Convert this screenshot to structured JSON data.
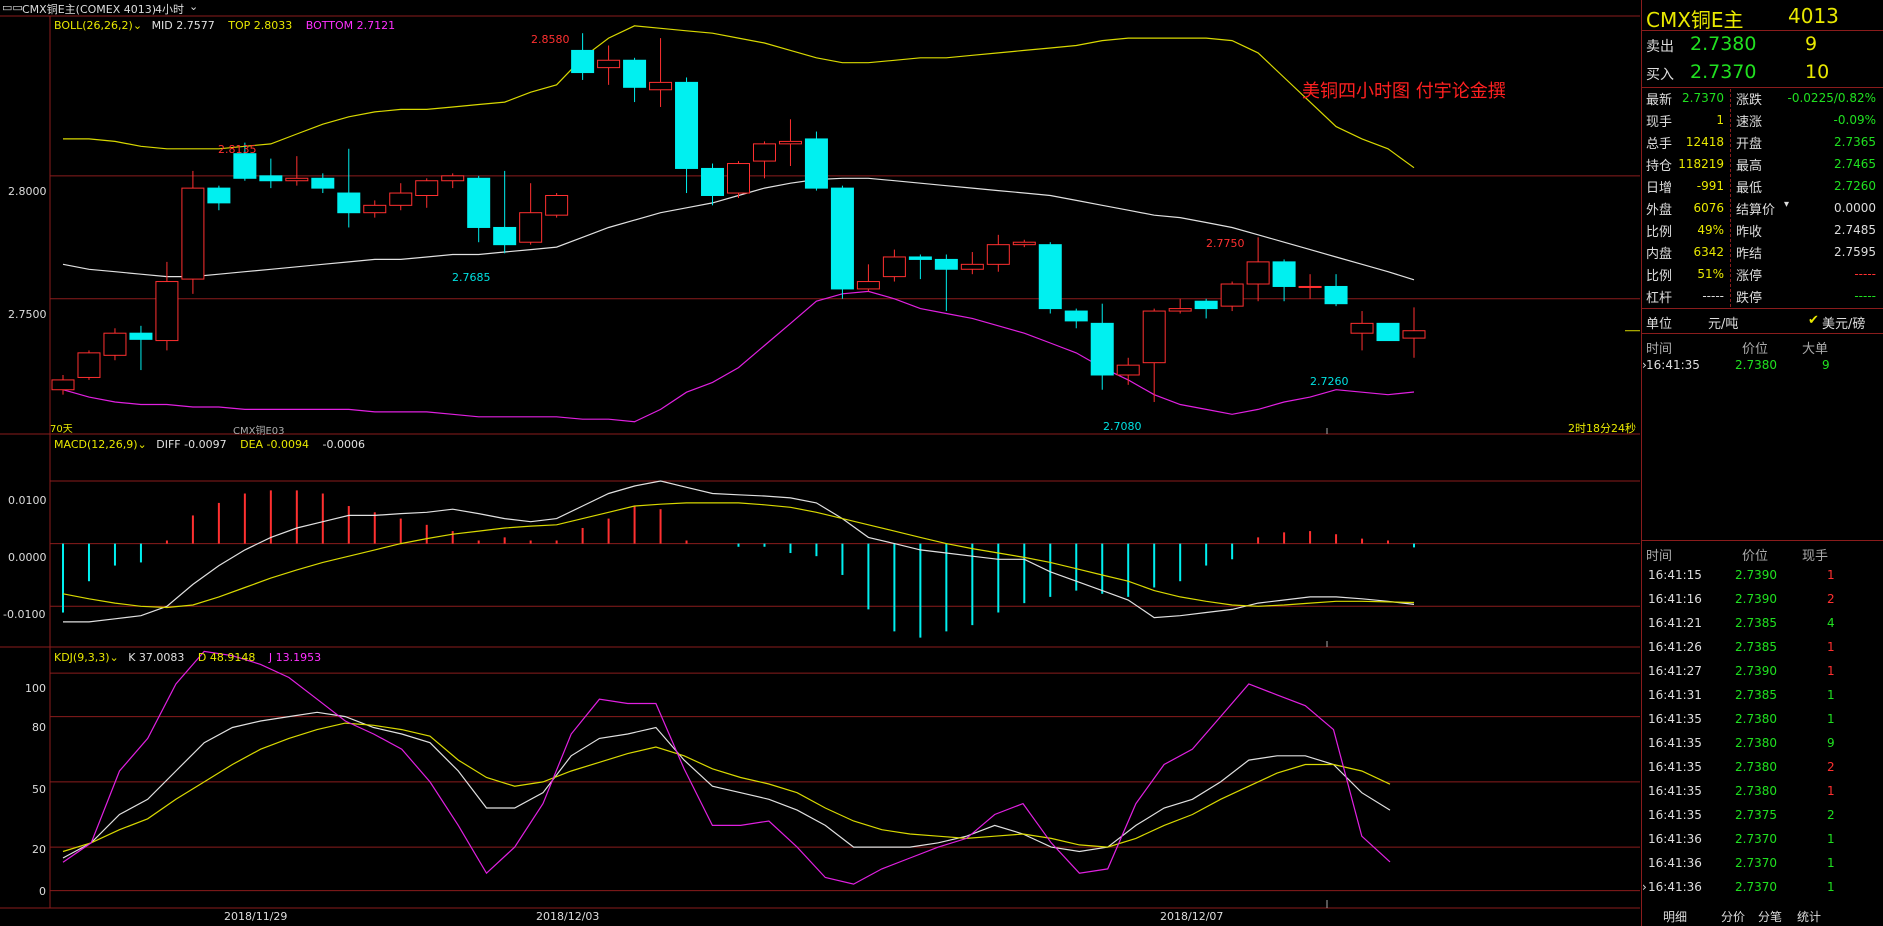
{
  "header": {
    "title": "CMX铜E主(COMEX 4013)",
    "period": "4小时",
    "period_chevron": "chevron-down-icon"
  },
  "boll": {
    "name": "BOLL(26,26,2)",
    "mid": "MID 2.7577",
    "top": "TOP 2.8033",
    "bottom": "BOTTOM 2.7121"
  },
  "macd": {
    "name": "MACD(12,26,9)",
    "diff": "DIFF -0.0097",
    "dea": "DEA -0.0094",
    "macd": "-0.0006"
  },
  "kdj": {
    "name": "KDJ(9,3,3)",
    "k": "K 37.0083",
    "d": "D 48.9148",
    "j": "J 13.1953"
  },
  "main_axis": {
    "labels": [
      "2.8000",
      "2.7500"
    ],
    "values": [
      2.8,
      2.75
    ]
  },
  "macd_axis": {
    "labels": [
      "0.0100",
      "0.0000",
      "-0.0100"
    ],
    "values": [
      0.01,
      0.0,
      -0.01
    ]
  },
  "kdj_axis": {
    "labels": [
      "100",
      "80",
      "50",
      "20",
      "0"
    ],
    "values": [
      100,
      80,
      50,
      20,
      0
    ]
  },
  "date_labels": [
    "2018/11/29",
    "2018/12/03",
    "2018/12/07"
  ],
  "annotations": {
    "watermark": "美铜四小时图 付宇论金撰",
    "hi1": "2.8135",
    "hi2": "2.8580",
    "lo1": "2.7685",
    "hi3": "2.7750",
    "lo2": "2.7080",
    "lo3": "2.7260",
    "left_tag": "70天",
    "sub_tag": "CMX铜E03",
    "countdown": "2时18分24秒"
  },
  "quote": {
    "symbol": "CMX铜E主",
    "code": "4013",
    "ask_label": "卖出",
    "ask_price": "2.7380",
    "ask_vol": "9",
    "bid_label": "买入",
    "bid_price": "2.7370",
    "bid_vol": "10",
    "rows": [
      {
        "l1": "最新",
        "v1": "2.7370",
        "c1": "grn",
        "l2": "涨跌",
        "v2": "-0.0225/0.82%",
        "c2": "grn"
      },
      {
        "l1": "现手",
        "v1": "1",
        "c1": "yel",
        "l2": "速涨",
        "v2": "-0.09%",
        "c2": "grn"
      },
      {
        "l1": "总手",
        "v1": "12418",
        "c1": "yel",
        "l2": "开盘",
        "v2": "2.7365",
        "c2": "grn"
      },
      {
        "l1": "持仓",
        "v1": "118219",
        "c1": "yel",
        "l2": "最高",
        "v2": "2.7465",
        "c2": "grn"
      },
      {
        "l1": "日增",
        "v1": "-991",
        "c1": "yel",
        "l2": "最低",
        "v2": "2.7260",
        "c2": "grn"
      },
      {
        "l1": "外盘",
        "v1": "6076",
        "c1": "yel",
        "l2": "结算价",
        "v2": "0.0000",
        "c2": "lbl"
      },
      {
        "l1": "比例",
        "v1": "49%",
        "c1": "yel",
        "l2": "昨收",
        "v2": "2.7485",
        "c2": "lbl"
      },
      {
        "l1": "内盘",
        "v1": "6342",
        "c1": "yel",
        "l2": "昨结",
        "v2": "2.7595",
        "c2": "lbl"
      },
      {
        "l1": "比例",
        "v1": "51%",
        "c1": "yel",
        "l2": "涨停",
        "v2": "-----",
        "c2": "red"
      },
      {
        "l1": "杠杆",
        "v1": "-----",
        "c1": "lbl",
        "l2": "跌停",
        "v2": "-----",
        "c2": "grn"
      }
    ],
    "unit_label": "单位",
    "unit_value": "元/吨",
    "unit_alt": "美元/磅",
    "unit_check": "check-icon"
  },
  "big_orders": {
    "headers": [
      "时间",
      "价位",
      "大单"
    ],
    "rows": [
      {
        "time": "16:41:35",
        "price": "2.7380",
        "vol": "9"
      }
    ]
  },
  "ticks": {
    "headers": [
      "时间",
      "价位",
      "现手"
    ],
    "rows": [
      {
        "time": "16:41:15",
        "price": "2.7390",
        "vol": "1",
        "c": "red"
      },
      {
        "time": "16:41:16",
        "price": "2.7390",
        "vol": "2",
        "c": "red"
      },
      {
        "time": "16:41:21",
        "price": "2.7385",
        "vol": "4",
        "c": "grn"
      },
      {
        "time": "16:41:26",
        "price": "2.7385",
        "vol": "1",
        "c": "red"
      },
      {
        "time": "16:41:27",
        "price": "2.7390",
        "vol": "1",
        "c": "red"
      },
      {
        "time": "16:41:31",
        "price": "2.7385",
        "vol": "1",
        "c": "grn"
      },
      {
        "time": "16:41:35",
        "price": "2.7380",
        "vol": "1",
        "c": "grn"
      },
      {
        "time": "16:41:35",
        "price": "2.7380",
        "vol": "9",
        "c": "grn"
      },
      {
        "time": "16:41:35",
        "price": "2.7380",
        "vol": "2",
        "c": "red"
      },
      {
        "time": "16:41:35",
        "price": "2.7380",
        "vol": "1",
        "c": "red"
      },
      {
        "time": "16:41:35",
        "price": "2.7375",
        "vol": "2",
        "c": "grn"
      },
      {
        "time": "16:41:36",
        "price": "2.7370",
        "vol": "1",
        "c": "grn"
      },
      {
        "time": "16:41:36",
        "price": "2.7370",
        "vol": "1",
        "c": "grn"
      },
      {
        "time": "16:41:36",
        "price": "2.7370",
        "vol": "1",
        "c": "grn"
      }
    ]
  },
  "tabs": [
    "明细",
    "分价",
    "分笔",
    "统计"
  ],
  "colors": {
    "up": "#ff3030",
    "down": "#00f0f0",
    "grid": "#8a1c1c",
    "mid": "#e0e0e0",
    "top": "#d8d800",
    "bottom": "#e020e0"
  },
  "chart_data": {
    "type": "candlestick",
    "candles": [
      {
        "o": 2.713,
        "c": 2.717,
        "h": 2.719,
        "l": 2.711
      },
      {
        "o": 2.718,
        "c": 2.728,
        "h": 2.729,
        "l": 2.717
      },
      {
        "o": 2.727,
        "c": 2.736,
        "h": 2.738,
        "l": 2.725
      },
      {
        "o": 2.736,
        "c": 2.7335,
        "h": 2.739,
        "l": 2.721
      },
      {
        "o": 2.733,
        "c": 2.757,
        "h": 2.765,
        "l": 2.729
      },
      {
        "o": 2.758,
        "c": 2.795,
        "h": 2.802,
        "l": 2.752
      },
      {
        "o": 2.795,
        "c": 2.789,
        "h": 2.796,
        "l": 2.786
      },
      {
        "o": 2.809,
        "c": 2.799,
        "h": 2.8135,
        "l": 2.798
      },
      {
        "o": 2.8,
        "c": 2.798,
        "h": 2.807,
        "l": 2.795
      },
      {
        "o": 2.798,
        "c": 2.799,
        "h": 2.808,
        "l": 2.796
      },
      {
        "o": 2.799,
        "c": 2.795,
        "h": 2.801,
        "l": 2.793
      },
      {
        "o": 2.793,
        "c": 2.785,
        "h": 2.811,
        "l": 2.779
      },
      {
        "o": 2.785,
        "c": 2.788,
        "h": 2.79,
        "l": 2.783
      },
      {
        "o": 2.788,
        "c": 2.793,
        "h": 2.797,
        "l": 2.786
      },
      {
        "o": 2.792,
        "c": 2.798,
        "h": 2.799,
        "l": 2.787
      },
      {
        "o": 2.798,
        "c": 2.8,
        "h": 2.801,
        "l": 2.795
      },
      {
        "o": 2.799,
        "c": 2.779,
        "h": 2.8,
        "l": 2.773
      },
      {
        "o": 2.779,
        "c": 2.772,
        "h": 2.802,
        "l": 2.7685
      },
      {
        "o": 2.773,
        "c": 2.785,
        "h": 2.797,
        "l": 2.772
      },
      {
        "o": 2.784,
        "c": 2.792,
        "h": 2.793,
        "l": 2.783
      },
      {
        "o": 2.851,
        "c": 2.842,
        "h": 2.858,
        "l": 2.839
      },
      {
        "o": 2.844,
        "c": 2.847,
        "h": 2.853,
        "l": 2.837
      },
      {
        "o": 2.847,
        "c": 2.836,
        "h": 2.848,
        "l": 2.83
      },
      {
        "o": 2.835,
        "c": 2.838,
        "h": 2.856,
        "l": 2.828
      },
      {
        "o": 2.838,
        "c": 2.803,
        "h": 2.84,
        "l": 2.793
      },
      {
        "o": 2.803,
        "c": 2.792,
        "h": 2.805,
        "l": 2.788
      },
      {
        "o": 2.793,
        "c": 2.805,
        "h": 2.806,
        "l": 2.791
      },
      {
        "o": 2.806,
        "c": 2.813,
        "h": 2.814,
        "l": 2.799
      },
      {
        "o": 2.813,
        "c": 2.814,
        "h": 2.823,
        "l": 2.804
      },
      {
        "o": 2.815,
        "c": 2.795,
        "h": 2.818,
        "l": 2.794
      },
      {
        "o": 2.795,
        "c": 2.754,
        "h": 2.796,
        "l": 2.75
      },
      {
        "o": 2.754,
        "c": 2.757,
        "h": 2.764,
        "l": 2.753
      },
      {
        "o": 2.759,
        "c": 2.767,
        "h": 2.77,
        "l": 2.757
      },
      {
        "o": 2.767,
        "c": 2.766,
        "h": 2.768,
        "l": 2.758
      },
      {
        "o": 2.766,
        "c": 2.762,
        "h": 2.768,
        "l": 2.745
      },
      {
        "o": 2.762,
        "c": 2.764,
        "h": 2.769,
        "l": 2.76
      },
      {
        "o": 2.764,
        "c": 2.772,
        "h": 2.776,
        "l": 2.761
      },
      {
        "o": 2.772,
        "c": 2.773,
        "h": 2.774,
        "l": 2.771
      },
      {
        "o": 2.772,
        "c": 2.746,
        "h": 2.773,
        "l": 2.744
      },
      {
        "o": 2.745,
        "c": 2.741,
        "h": 2.746,
        "l": 2.738
      },
      {
        "o": 2.74,
        "c": 2.719,
        "h": 2.748,
        "l": 2.713
      },
      {
        "o": 2.719,
        "c": 2.723,
        "h": 2.726,
        "l": 2.715
      },
      {
        "o": 2.724,
        "c": 2.745,
        "h": 2.746,
        "l": 2.708
      },
      {
        "o": 2.745,
        "c": 2.746,
        "h": 2.75,
        "l": 2.744
      },
      {
        "o": 2.749,
        "c": 2.746,
        "h": 2.75,
        "l": 2.742
      },
      {
        "o": 2.747,
        "c": 2.756,
        "h": 2.757,
        "l": 2.745
      },
      {
        "o": 2.756,
        "c": 2.765,
        "h": 2.775,
        "l": 2.749
      },
      {
        "o": 2.765,
        "c": 2.755,
        "h": 2.766,
        "l": 2.749
      },
      {
        "o": 2.755,
        "c": 2.755,
        "h": 2.76,
        "l": 2.75
      },
      {
        "o": 2.755,
        "c": 2.748,
        "h": 2.76,
        "l": 2.747
      },
      {
        "o": 2.736,
        "c": 2.74,
        "h": 2.745,
        "l": 2.729
      },
      {
        "o": 2.74,
        "c": 2.733,
        "h": 2.74,
        "l": 2.733
      },
      {
        "o": 2.734,
        "c": 2.737,
        "h": 2.7465,
        "l": 2.726
      }
    ],
    "boll_mid": [
      2.764,
      2.762,
      2.761,
      2.76,
      2.759,
      2.759,
      2.76,
      2.761,
      2.762,
      2.763,
      2.764,
      2.765,
      2.766,
      2.766,
      2.767,
      2.768,
      2.768,
      2.769,
      2.77,
      2.771,
      2.775,
      2.779,
      2.782,
      2.785,
      2.787,
      2.789,
      2.792,
      2.795,
      2.797,
      2.7985,
      2.799,
      2.799,
      2.798,
      2.797,
      2.796,
      2.795,
      2.794,
      2.793,
      2.792,
      2.79,
      2.788,
      2.786,
      2.784,
      2.783,
      2.781,
      2.779,
      2.776,
      2.773,
      2.77,
      2.767,
      2.764,
      2.761,
      2.7577
    ],
    "boll_top": [
      2.815,
      2.815,
      2.814,
      2.812,
      2.811,
      2.811,
      2.811,
      2.812,
      2.813,
      2.817,
      2.821,
      2.824,
      2.826,
      2.827,
      2.827,
      2.828,
      2.829,
      2.83,
      2.834,
      2.837,
      2.848,
      2.856,
      2.861,
      2.86,
      2.859,
      2.858,
      2.856,
      2.854,
      2.851,
      2.848,
      2.846,
      2.846,
      2.847,
      2.848,
      2.848,
      2.849,
      2.85,
      2.851,
      2.852,
      2.853,
      2.855,
      2.856,
      2.856,
      2.856,
      2.856,
      2.855,
      2.85,
      2.84,
      2.83,
      2.82,
      2.815,
      2.811,
      2.8033
    ],
    "boll_bottom": [
      2.713,
      2.71,
      2.708,
      2.707,
      2.707,
      2.706,
      2.706,
      2.705,
      2.705,
      2.705,
      2.705,
      2.705,
      2.704,
      2.704,
      2.704,
      2.703,
      2.702,
      2.702,
      2.702,
      2.702,
      2.701,
      2.701,
      2.7,
      2.705,
      2.712,
      2.716,
      2.722,
      2.731,
      2.74,
      2.749,
      2.752,
      2.753,
      2.75,
      2.746,
      2.744,
      2.742,
      2.739,
      2.736,
      2.732,
      2.728,
      2.722,
      2.717,
      2.711,
      2.707,
      2.705,
      2.703,
      2.705,
      2.708,
      2.71,
      2.713,
      2.712,
      2.711,
      2.7121
    ],
    "macd_hist": [
      -0.011,
      -0.006,
      -0.0035,
      -0.003,
      0.0005,
      0.0045,
      0.0065,
      0.008,
      0.0085,
      0.0085,
      0.008,
      0.006,
      0.005,
      0.004,
      0.003,
      0.002,
      0.0005,
      0.001,
      0.0005,
      0.0005,
      0.0025,
      0.004,
      0.006,
      0.0055,
      0.0005,
      0.0,
      -0.0005,
      -0.0005,
      -0.0015,
      -0.002,
      -0.005,
      -0.0105,
      -0.014,
      -0.015,
      -0.014,
      -0.013,
      -0.011,
      -0.0095,
      -0.0085,
      -0.0075,
      -0.008,
      -0.0085,
      -0.007,
      -0.006,
      -0.0035,
      -0.0025,
      0.001,
      0.0018,
      0.002,
      0.0015,
      0.0008,
      0.0005,
      -0.0006
    ],
    "macd_diff": [
      -0.0125,
      -0.0125,
      -0.012,
      -0.0115,
      -0.01,
      -0.0065,
      -0.0035,
      -0.001,
      0.001,
      0.0025,
      0.0035,
      0.0045,
      0.0045,
      0.0048,
      0.005,
      0.0055,
      0.0048,
      0.004,
      0.0035,
      0.004,
      0.006,
      0.008,
      0.0092,
      0.01,
      0.009,
      0.008,
      0.0078,
      0.0076,
      0.0073,
      0.0065,
      0.004,
      0.001,
      0.0,
      -0.001,
      -0.0015,
      -0.002,
      -0.0025,
      -0.0025,
      -0.0045,
      -0.006,
      -0.0075,
      -0.009,
      -0.0118,
      -0.0115,
      -0.011,
      -0.0105,
      -0.0095,
      -0.009,
      -0.0085,
      -0.0085,
      -0.0088,
      -0.0092,
      -0.0097
    ],
    "macd_dea": [
      -0.008,
      -0.0088,
      -0.0095,
      -0.01,
      -0.0102,
      -0.0098,
      -0.0085,
      -0.007,
      -0.0055,
      -0.0042,
      -0.003,
      -0.002,
      -0.001,
      0.0,
      0.0008,
      0.0015,
      0.002,
      0.0025,
      0.0028,
      0.003,
      0.004,
      0.005,
      0.006,
      0.0063,
      0.0065,
      0.0065,
      0.0065,
      0.0062,
      0.0058,
      0.005,
      0.004,
      0.003,
      0.002,
      0.001,
      0.0,
      -0.0008,
      -0.0015,
      -0.0022,
      -0.003,
      -0.004,
      -0.005,
      -0.006,
      -0.0075,
      -0.0085,
      -0.0092,
      -0.0098,
      -0.01,
      -0.0098,
      -0.0095,
      -0.0092,
      -0.0092,
      -0.0093,
      -0.0094
    ],
    "kdj_k": [
      15,
      22,
      35,
      42,
      55,
      68,
      75,
      78,
      80,
      82,
      80,
      75,
      72,
      68,
      55,
      38,
      38,
      45,
      62,
      70,
      72,
      75,
      60,
      48,
      45,
      42,
      37,
      30,
      20,
      20,
      20,
      22,
      25,
      30,
      26,
      20,
      18,
      20,
      30,
      38,
      42,
      50,
      60,
      62,
      62,
      58,
      45,
      37
    ],
    "kdj_d": [
      18,
      22,
      28,
      33,
      42,
      50,
      58,
      65,
      70,
      74,
      77,
      76,
      74,
      71,
      60,
      52,
      48,
      50,
      55,
      59,
      63,
      66,
      62,
      56,
      52,
      49,
      45,
      38,
      32,
      28,
      26,
      25,
      24,
      25,
      26,
      24,
      21,
      20,
      24,
      30,
      35,
      42,
      48,
      54,
      58,
      58,
      55,
      48.9
    ],
    "kdj_j": [
      13,
      22,
      55,
      70,
      95,
      110,
      108,
      104,
      98,
      88,
      78,
      72,
      65,
      50,
      30,
      8,
      20,
      40,
      72,
      88,
      86,
      86,
      56,
      30,
      30,
      32,
      20,
      6,
      3,
      10,
      15,
      20,
      24,
      35,
      40,
      22,
      8,
      10,
      40,
      58,
      65,
      80,
      95,
      90,
      85,
      74,
      25,
      13.2
    ]
  }
}
